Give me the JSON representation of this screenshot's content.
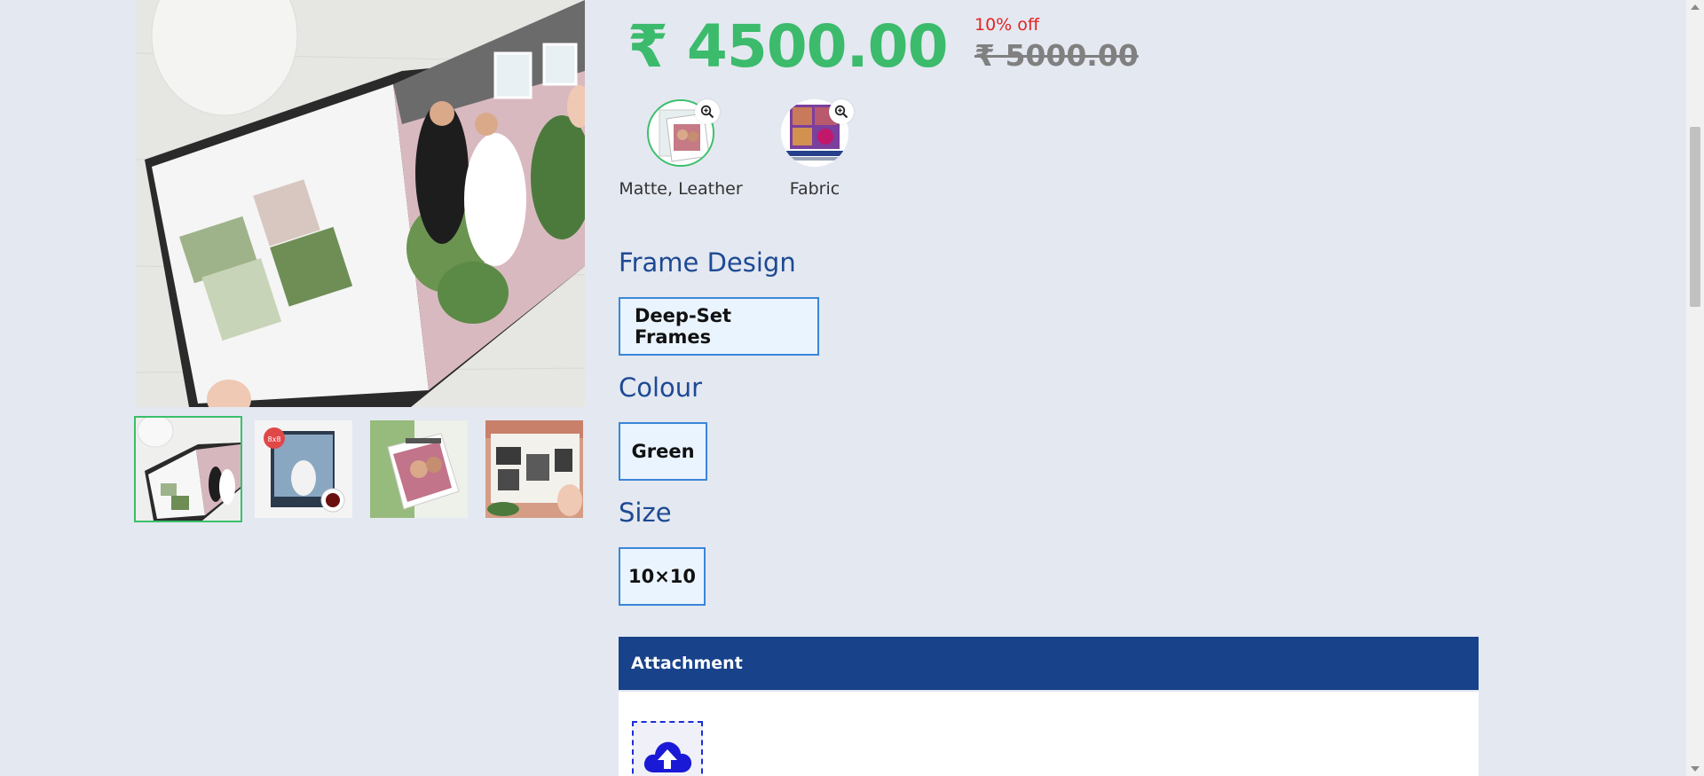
{
  "product": {
    "price": "₹ 4500.00",
    "discount": "10% off",
    "old_price": "₹ 5000.00"
  },
  "finishes": [
    {
      "label": "Matte, Leather",
      "selected": true,
      "icon": "zoom-in-icon"
    },
    {
      "label": "Fabric",
      "selected": false,
      "icon": "zoom-in-icon"
    }
  ],
  "frame_design": {
    "title": "Frame Design",
    "value": "Deep-Set Frames"
  },
  "colour": {
    "title": "Colour",
    "value": "Green"
  },
  "size": {
    "title": "Size",
    "value": "10×10"
  },
  "attachment": {
    "title": "Attachment",
    "upload_icon": "cloud-upload-icon"
  },
  "gallery": {
    "thumbnail_count": 4,
    "active_index": 0,
    "badge_text": "8x8"
  }
}
